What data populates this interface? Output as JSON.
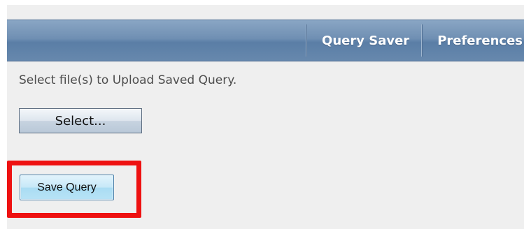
{
  "nav": {
    "items": [
      {
        "label": "Query Saver"
      },
      {
        "label": "Preferences"
      }
    ]
  },
  "upload": {
    "instruction": "Select file(s) to Upload Saved Query.",
    "select_label": "Select..."
  },
  "actions": {
    "save_label": "Save Query"
  },
  "colors": {
    "header_bar": "#6f8fb3",
    "panel_background": "#efefef",
    "highlight_border": "#ee1111",
    "save_button": "#b8e3f6"
  }
}
